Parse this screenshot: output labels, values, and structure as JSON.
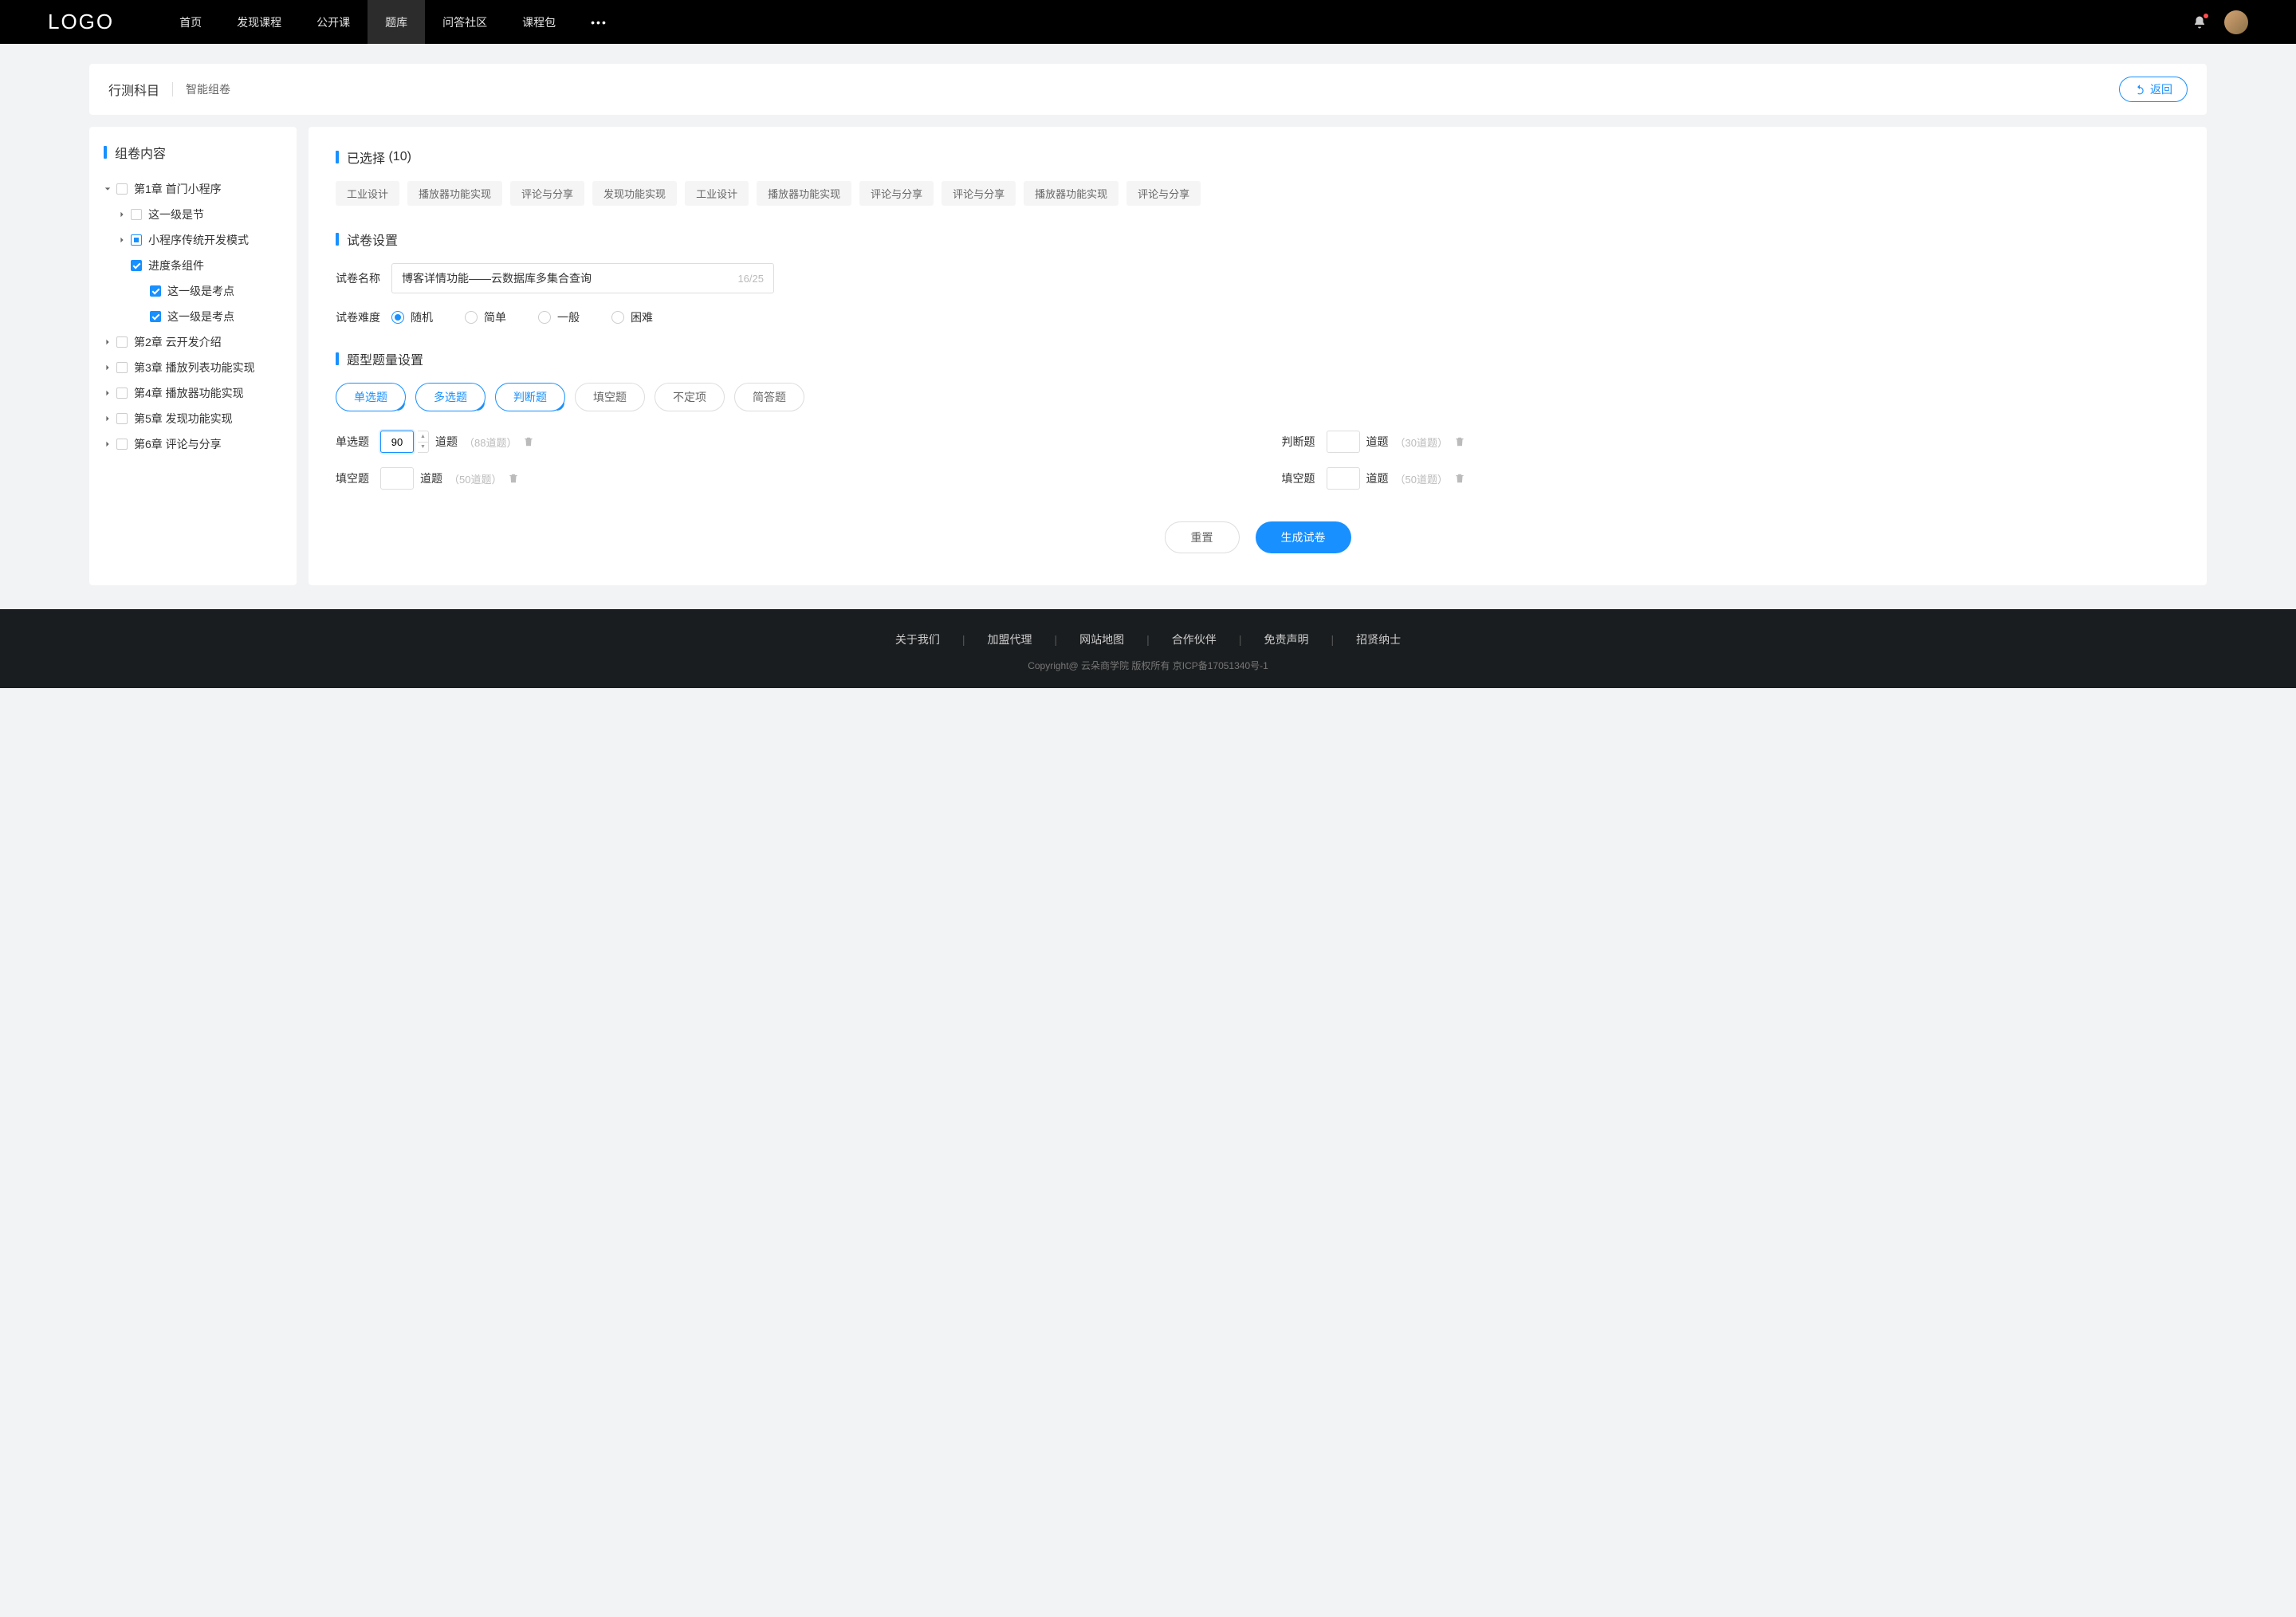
{
  "header": {
    "logo": "LOGO",
    "nav": [
      "首页",
      "发现课程",
      "公开课",
      "题库",
      "问答社区",
      "课程包"
    ],
    "active_index": 3,
    "more": "•••"
  },
  "page": {
    "title": "行测科目",
    "subtitle": "智能组卷",
    "back_label": "返回"
  },
  "sidebar": {
    "title": "组卷内容",
    "tree": [
      {
        "label": "第1章 首门小程序",
        "expanded": true,
        "state": "unchecked",
        "children": [
          {
            "label": "这一级是节",
            "state": "unchecked",
            "expandable": true
          },
          {
            "label": "小程序传统开发模式",
            "state": "indeterminate",
            "expandable": true
          },
          {
            "label": "进度条组件",
            "state": "checked",
            "expandable": false,
            "children": [
              {
                "label": "这一级是考点",
                "state": "checked"
              },
              {
                "label": "这一级是考点",
                "state": "checked"
              }
            ]
          }
        ]
      },
      {
        "label": "第2章 云开发介绍",
        "state": "unchecked",
        "expandable": true
      },
      {
        "label": "第3章 播放列表功能实现",
        "state": "unchecked",
        "expandable": true
      },
      {
        "label": "第4章 播放器功能实现",
        "state": "unchecked",
        "expandable": true
      },
      {
        "label": "第5章 发现功能实现",
        "state": "unchecked",
        "expandable": true
      },
      {
        "label": "第6章 评论与分享",
        "state": "unchecked",
        "expandable": true
      }
    ]
  },
  "selected": {
    "title_prefix": "已选择",
    "count": 10,
    "tags": [
      "工业设计",
      "播放器功能实现",
      "评论与分享",
      "发现功能实现",
      "工业设计",
      "播放器功能实现",
      "评论与分享",
      "评论与分享",
      "播放器功能实现",
      "评论与分享"
    ]
  },
  "paper_settings": {
    "title": "试卷设置",
    "name_label": "试卷名称",
    "name_value": "博客详情功能——云数据库多集合查询",
    "name_counter": "16/25",
    "difficulty_label": "试卷难度",
    "difficulty_options": [
      "随机",
      "简单",
      "一般",
      "困难"
    ],
    "difficulty_selected": 0
  },
  "type_settings": {
    "title": "题型题量设置",
    "types": [
      {
        "label": "单选题",
        "selected": true
      },
      {
        "label": "多选题",
        "selected": true
      },
      {
        "label": "判断题",
        "selected": true
      },
      {
        "label": "填空题",
        "selected": false
      },
      {
        "label": "不定项",
        "selected": false
      },
      {
        "label": "简答题",
        "selected": false
      }
    ],
    "quantities": [
      {
        "label": "单选题",
        "value": "90",
        "unit": "道题",
        "hint": "（88道题）",
        "focused": true,
        "stepper": true
      },
      {
        "label": "判断题",
        "value": "",
        "unit": "道题",
        "hint": "（30道题）"
      },
      {
        "label": "填空题",
        "value": "",
        "unit": "道题",
        "hint": "（50道题）"
      },
      {
        "label": "填空题",
        "value": "",
        "unit": "道题",
        "hint": "（50道题）"
      }
    ]
  },
  "actions": {
    "reset": "重置",
    "generate": "生成试卷"
  },
  "footer": {
    "links": [
      "关于我们",
      "加盟代理",
      "网站地图",
      "合作伙伴",
      "免责声明",
      "招贤纳士"
    ],
    "copyright": "Copyright@  云朵商学院    版权所有        京ICP备17051340号-1"
  }
}
